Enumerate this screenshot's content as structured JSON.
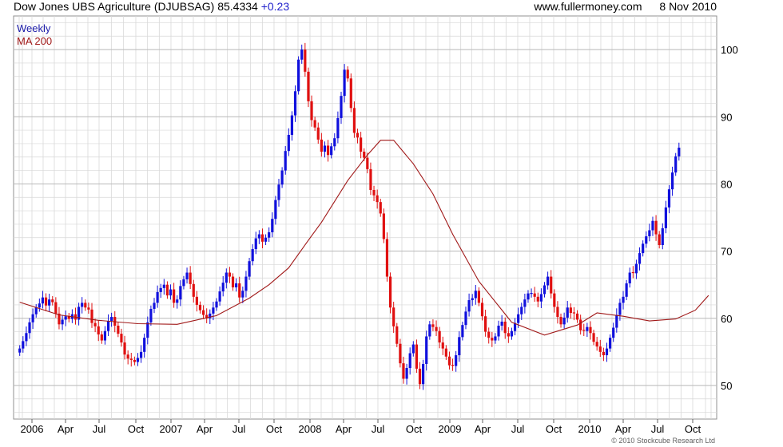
{
  "header": {
    "title": "Dow Jones UBS Agriculture (DJUBSAG)",
    "last": "85.4334",
    "change": "+0.23",
    "source": "www.fullermoney.com",
    "date": "8 Nov 2010"
  },
  "copyright": "© 2010 Stockcube Research Ltd",
  "colors": {
    "up": "#1010dd",
    "down": "#e01010",
    "ma": "#a01818",
    "grid": "#d8d8d8",
    "frame": "#909090"
  },
  "chart_data": {
    "type": "candlestick",
    "frequency": "weekly",
    "ylim": [
      45,
      105
    ],
    "yticks": [
      50,
      60,
      70,
      80,
      90,
      100
    ],
    "xticks": [
      "2006",
      "Apr",
      "Jul",
      "Oct",
      "2007",
      "Apr",
      "Jul",
      "Oct",
      "2008",
      "Apr",
      "Jul",
      "Oct",
      "2009",
      "Apr",
      "Jul",
      "Oct",
      "2010",
      "Apr",
      "Jul",
      "Oct"
    ],
    "legend": [
      "Weekly",
      "MA 200"
    ],
    "legend_position": "top-left",
    "grid": true,
    "y_axis_side": "right",
    "series": [
      {
        "name": "Weekly",
        "kind": "close",
        "values": [
          55.5,
          56.6,
          57.8,
          59.4,
          60.6,
          61.6,
          62.2,
          63.1,
          61.9,
          62.8,
          62.4,
          60.7,
          59.1,
          59.8,
          60.3,
          59.9,
          60.6,
          59.8,
          61.7,
          62.3,
          61.6,
          61.3,
          59.3,
          58.8,
          57.6,
          56.7,
          58.1,
          59.6,
          60.2,
          58.9,
          57.7,
          56.4,
          54.6,
          54.0,
          53.8,
          53.5,
          54.1,
          55.0,
          57.1,
          59.4,
          61.4,
          62.3,
          63.9,
          64.5,
          65.0,
          63.4,
          64.3,
          62.3,
          62.8,
          64.8,
          65.8,
          66.8,
          65.1,
          63.2,
          62.0,
          61.2,
          60.5,
          60.0,
          60.7,
          61.6,
          62.5,
          64.0,
          65.3,
          66.8,
          66.2,
          64.6,
          65.2,
          63.1,
          64.1,
          66.2,
          68.5,
          70.3,
          71.9,
          72.5,
          71.4,
          72.0,
          72.8,
          74.8,
          77.6,
          79.9,
          82.0,
          84.9,
          87.3,
          90.2,
          93.8,
          98.5,
          100.0,
          96.7,
          92.3,
          89.5,
          88.4,
          86.6,
          84.8,
          85.7,
          84.3,
          85.6,
          86.8,
          89.8,
          93.1,
          97.0,
          95.7,
          91.3,
          87.6,
          86.9,
          84.8,
          83.9,
          82.2,
          79.1,
          78.3,
          77.3,
          75.6,
          71.8,
          66.2,
          61.6,
          58.8,
          56.2,
          53.3,
          51.0,
          52.6,
          54.8,
          56.1,
          52.5,
          50.2,
          53.2,
          57.3,
          59.1,
          58.7,
          58.1,
          56.4,
          55.5,
          54.3,
          53.0,
          52.9,
          54.5,
          57.2,
          59.0,
          61.0,
          62.7,
          63.0,
          64.1,
          62.3,
          60.3,
          58.0,
          57.1,
          56.7,
          57.3,
          58.9,
          59.5,
          57.8,
          57.3,
          58.1,
          59.3,
          60.6,
          61.7,
          62.8,
          63.7,
          63.7,
          63.2,
          62.5,
          63.6,
          64.9,
          66.2,
          63.7,
          61.7,
          60.2,
          59.1,
          60.1,
          61.6,
          60.8,
          60.7,
          59.8,
          58.2,
          58.1,
          58.7,
          57.8,
          56.5,
          55.8,
          55.0,
          54.5,
          55.5,
          57.1,
          58.6,
          60.5,
          62.3,
          63.2,
          65.2,
          66.8,
          66.7,
          68.1,
          69.7,
          71.1,
          72.2,
          73.1,
          74.5,
          72.5,
          70.9,
          73.4,
          76.5,
          79.2,
          81.7,
          84.1,
          85.4
        ]
      },
      {
        "name": "MA 200",
        "kind": "moving_average",
        "x": [
          0,
          12,
          24,
          36,
          48,
          60,
          70,
          76,
          82,
          88,
          92,
          100,
          106,
          110,
          114,
          120,
          126,
          132,
          140,
          150,
          160,
          170,
          176,
          184,
          192,
          200,
          206,
          210
        ],
        "values": [
          62.4,
          60.5,
          59.7,
          59.2,
          59.1,
          60.4,
          63.0,
          65.0,
          67.5,
          71.6,
          74.3,
          80.5,
          84.3,
          86.5,
          86.5,
          83.0,
          78.5,
          72.5,
          65.5,
          59.4,
          57.5,
          59.0,
          60.8,
          60.3,
          59.6,
          59.9,
          61.2,
          63.4
        ]
      }
    ]
  }
}
